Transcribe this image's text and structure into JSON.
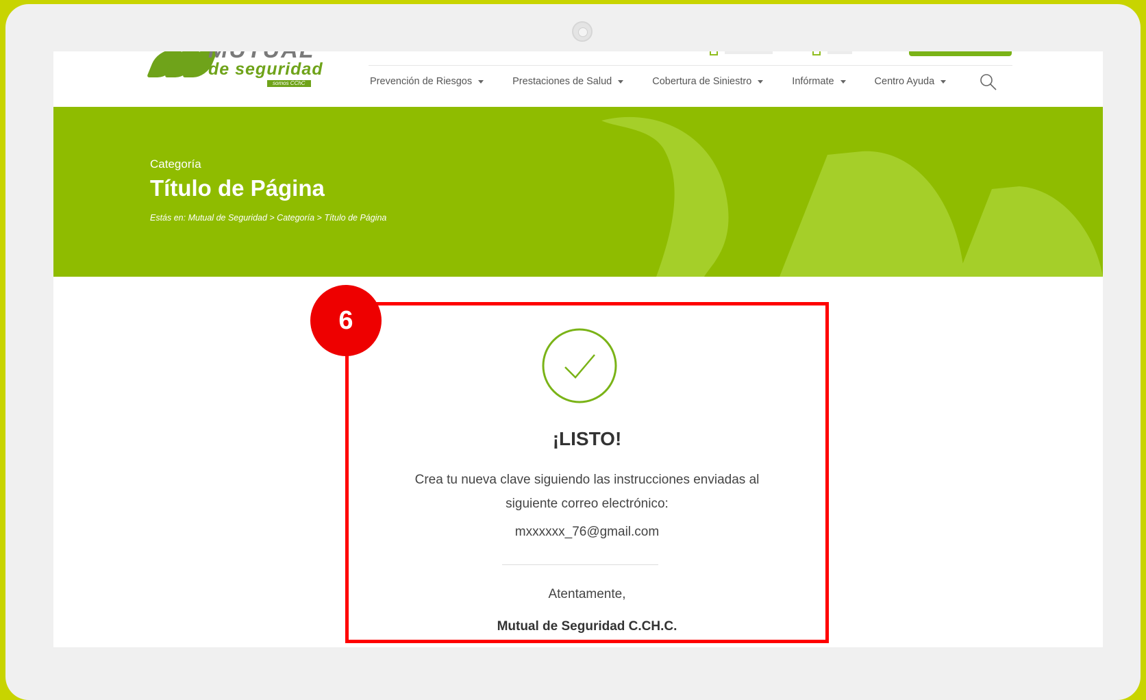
{
  "colors": {
    "accent": "#8fbc00",
    "brand_green": "#6fa31a",
    "highlight": "#ff0000"
  },
  "logo": {
    "line1": "MUTUAL",
    "line2": "de seguridad",
    "tag": "somos CChC"
  },
  "nav": {
    "items": [
      {
        "label": "Prevención de Riesgos"
      },
      {
        "label": "Prestaciones de Salud"
      },
      {
        "label": "Cobertura de Siniestro"
      },
      {
        "label": "Infórmate"
      },
      {
        "label": "Centro Ayuda"
      }
    ],
    "search_icon": "search-icon"
  },
  "hero": {
    "category": "Categoría",
    "title": "Título de Página",
    "breadcrumb": "Estás en: Mutual de Seguridad > Categoría > Título de Página"
  },
  "step_badge": "6",
  "confirmation": {
    "icon": "check-circle-icon",
    "heading": "¡LISTO!",
    "message_line1": "Crea tu nueva clave siguiendo las instrucciones enviadas al",
    "message_line2": "siguiente correo electrónico:",
    "email": "mxxxxxx_76@gmail.com",
    "closing": "Atentamente,",
    "signature": "Mutual de Seguridad C.CH.C."
  }
}
